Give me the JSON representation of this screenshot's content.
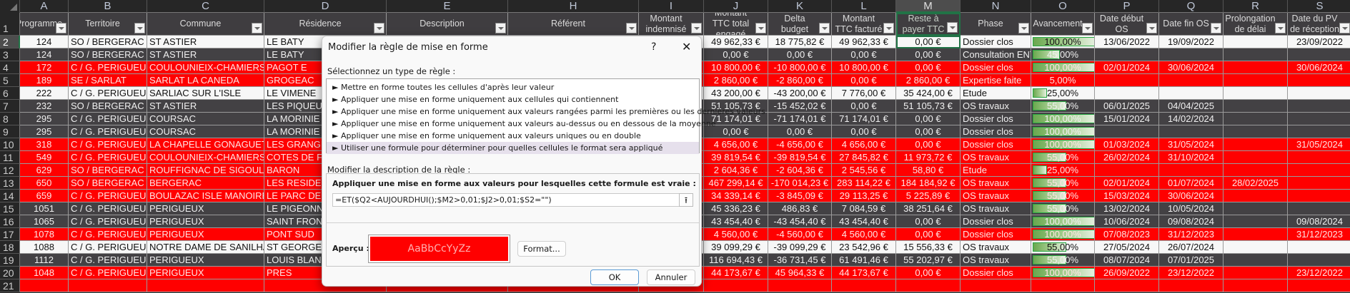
{
  "column_letters": [
    "A",
    "B",
    "C",
    "D",
    "E",
    "H",
    "I",
    "J",
    "K",
    "L",
    "M",
    "N",
    "O",
    "P",
    "Q",
    "R",
    "S"
  ],
  "selected_column": "M",
  "selected_row": "2",
  "colors": {
    "row_white": "#f7f7f7",
    "row_dark": "#434144",
    "row_red": "#ff0000",
    "selection": "#217346",
    "databar": "#6aa84f"
  },
  "headers": [
    "Programme",
    "Territoire",
    "Commune",
    "Résidence",
    "Description",
    "Référent",
    "Montant indemnisé",
    "Montant TTC total engagé",
    "Delta budget",
    "Montant TTC facturé",
    "Reste à payer TTC",
    "Phase",
    "Avancement",
    "Date début OS",
    "Date fin OS",
    "Prolongation de délai",
    "Date du PV de réception"
  ],
  "row_numbers": [
    "1",
    "2",
    "3",
    "4",
    "5",
    "6",
    "7",
    "8",
    "9",
    "10",
    "11",
    "12",
    "13",
    "14",
    "15",
    "16",
    "17",
    "18",
    "19",
    "20",
    "21"
  ],
  "rows": [
    {
      "style": "white",
      "cells": [
        "124",
        "SO / BERGERAC",
        "ST ASTIER",
        "LE BATY",
        "",
        "",
        "",
        "49 962,33 €",
        "18 775,82 €",
        "49 962,33 €",
        "0,00 €",
        "Dossier clos",
        "100,00%",
        "13/06/2022",
        "19/09/2022",
        "",
        "23/09/2022"
      ],
      "progress": 100
    },
    {
      "style": "dark",
      "cells": [
        "124",
        "SO / BERGERAC",
        "ST ASTIER",
        "LE BATY",
        "",
        "",
        "",
        "0,00 €",
        "0,00 €",
        "0,00 €",
        "0,00 €",
        "Consultation ENT",
        "45,00%",
        "",
        "",
        "",
        ""
      ],
      "progress": 45
    },
    {
      "style": "red",
      "cells": [
        "172",
        "C / G. PERIGUEUX",
        "COULOUNIEIX-CHAMIERS",
        "PAGOT E",
        "",
        "",
        "",
        "10 800,00 €",
        "-10 800,00 €",
        "10 800,00 €",
        "0,00 €",
        "Dossier clos",
        "100,00%",
        "02/01/2024",
        "30/06/2024",
        "",
        "30/06/2024"
      ],
      "progress": 100
    },
    {
      "style": "red",
      "cells": [
        "189",
        "SE / SARLAT",
        "SARLAT LA CANEDA",
        "GROGEAC",
        "",
        "",
        "",
        "2 860,00 €",
        "-2 860,00 €",
        "0,00 €",
        "2 860,00 €",
        "Expertise faite",
        "5,00%",
        "",
        "",
        "",
        ""
      ],
      "progress": 5
    },
    {
      "style": "white",
      "cells": [
        "222",
        "C / G. PERIGUEUX",
        "SARLIAC SUR L'ISLE",
        "LE VIMENE",
        "",
        "",
        "",
        "43 200,00 €",
        "-43 200,00 €",
        "7 776,00 €",
        "35 424,00 €",
        "Etude",
        "25,00%",
        "",
        "",
        "",
        ""
      ],
      "progress": 25
    },
    {
      "style": "dark",
      "cells": [
        "232",
        "SO / BERGERAC",
        "ST ASTIER",
        "LES PIQUEURS",
        "",
        "",
        "",
        "51 105,73 €",
        "-15 452,02 €",
        "0,00 €",
        "51 105,73 €",
        "OS travaux",
        "55,00%",
        "06/01/2025",
        "04/04/2025",
        "",
        ""
      ],
      "progress": 55
    },
    {
      "style": "dark",
      "cells": [
        "295",
        "C / G. PERIGUEUX",
        "COURSAC",
        "LA MORINIE 1",
        "",
        "",
        "",
        "71 174,01 €",
        "-71 174,01 €",
        "71 174,01 €",
        "0,00 €",
        "Dossier clos",
        "100,00%",
        "15/01/2024",
        "14/02/2024",
        "",
        ""
      ],
      "progress": 100
    },
    {
      "style": "dark",
      "cells": [
        "295",
        "C / G. PERIGUEUX",
        "COURSAC",
        "LA MORINIE 1",
        "",
        "",
        "",
        "0,00 €",
        "0,00 €",
        "0,00 €",
        "0,00 €",
        "Dossier clos",
        "100,00%",
        "",
        "",
        "",
        ""
      ],
      "progress": 100
    },
    {
      "style": "red",
      "cells": [
        "318",
        "C / G. PERIGUEUX",
        "LA CHAPELLE GONAGUET",
        "LES GRANGES",
        "",
        "",
        "",
        "4 656,00 €",
        "-4 656,00 €",
        "4 656,00 €",
        "0,00 €",
        "Dossier clos",
        "100,00%",
        "01/03/2024",
        "31/05/2024",
        "",
        "31/05/2024"
      ],
      "progress": 100
    },
    {
      "style": "red",
      "cells": [
        "549",
        "C / G. PERIGUEUX",
        "COULOUNIEIX-CHAMIERS",
        "COTES DE FRA",
        "",
        "",
        "",
        "39 819,54 €",
        "-39 819,54 €",
        "27 845,82 €",
        "11 973,72 €",
        "OS travaux",
        "55,00%",
        "26/02/2024",
        "31/10/2024",
        "",
        ""
      ],
      "progress": 55
    },
    {
      "style": "red",
      "cells": [
        "629",
        "SO / BERGERAC",
        "ROUFFIGNAC DE SIGOULES",
        " BARON",
        "",
        "",
        "",
        "2 604,36 €",
        "-2 604,36 €",
        "2 545,56 €",
        "58,80 €",
        "Etude",
        "25,00%",
        "",
        "",
        "",
        ""
      ],
      "progress": 25
    },
    {
      "style": "red",
      "cells": [
        "650",
        "SO / BERGERAC",
        "BERGERAC",
        "LES RESIDENC",
        "",
        "",
        "",
        "467 299,14 €",
        "-170 014,23 €",
        "283 114,22 €",
        "184 184,92 €",
        "OS travaux",
        "55,00%",
        "02/01/2024",
        "01/07/2024",
        "28/02/2025",
        ""
      ],
      "progress": 55
    },
    {
      "style": "red",
      "cells": [
        "659",
        "C / G. PERIGUEUX",
        "BOULAZAC ISLE MANOIRE",
        "LE PARC DES F",
        "",
        "",
        "",
        "34 339,14 €",
        "-3 845,09 €",
        "29 113,25 €",
        "5 225,89 €",
        "OS travaux",
        "55,00%",
        "15/03/2024",
        "30/06/2024",
        "",
        ""
      ],
      "progress": 55
    },
    {
      "style": "dark",
      "cells": [
        "1051",
        "C / G. PERIGUEUX",
        "PERIGUEUX",
        "LE PIGEONNIE",
        "",
        "",
        "",
        "45 336,23 €",
        "486,83 €",
        "7 084,59 €",
        "38 251,64 €",
        "OS travaux",
        "55,00%",
        "13/02/2024",
        "10/05/2024",
        "",
        ""
      ],
      "progress": 55
    },
    {
      "style": "dark",
      "cells": [
        "1065",
        "C / G. PERIGUEUX",
        "PERIGUEUX",
        "SAINT FRONT",
        "",
        "",
        "",
        "43 454,40 €",
        "-43 454,40 €",
        "43 454,40 €",
        "0,00 €",
        "Dossier clos",
        "100,00%",
        "10/06/2024",
        "09/08/2024",
        "",
        "09/08/2024"
      ],
      "progress": 100
    },
    {
      "style": "red",
      "cells": [
        "1078",
        "C / G. PERIGUEUX",
        "PERIGUEUX",
        "PONT SUD",
        "",
        "",
        "",
        "4 560,00 €",
        "-4 560,00 €",
        "4 560,00 €",
        "0,00 €",
        "Dossier clos",
        "100,00%",
        "07/08/2023",
        "31/12/2023",
        "",
        "31/12/2023"
      ],
      "progress": 100
    },
    {
      "style": "white",
      "cells": [
        "1088",
        "C / G. PERIGUEUX",
        "NOTRE DAME DE SANILHAC",
        "ST GEORGES",
        "",
        "",
        "",
        "39 099,29 €",
        "-39 099,29 €",
        "23 542,96 €",
        "15 556,33 €",
        "OS travaux",
        "55,00%",
        "27/05/2024",
        "26/07/2024",
        "",
        ""
      ],
      "progress": 55
    },
    {
      "style": "dark",
      "cells": [
        "1112",
        "C / G. PERIGUEUX",
        "PERIGUEUX",
        "LOUIS BLANC",
        "",
        "",
        "",
        "116 694,43 €",
        "-36 731,45 €",
        "61 491,46 €",
        "55 202,97 €",
        "OS travaux",
        "55,00%",
        "08/07/2024",
        "07/01/2025",
        "",
        ""
      ],
      "progress": 55
    },
    {
      "style": "red",
      "cells": [
        "1048",
        "C / G. PERIGUEUX",
        "PERIGUEUX",
        "PRES",
        "",
        "",
        "",
        "44 173,67 €",
        "45 964,33 €",
        "44 173,67 €",
        "0,00 €",
        "Dossier clos",
        "100,00%",
        "26/09/2022",
        "23/12/2022",
        "",
        "23/12/2022"
      ],
      "progress": 100
    },
    {
      "style": "red",
      "cells": [
        "",
        "",
        "",
        "",
        "",
        "",
        "",
        "",
        "",
        "",
        "",
        "",
        "",
        "",
        "",
        "",
        ""
      ],
      "progress": null
    }
  ],
  "dialog": {
    "title": "Modifier la règle de mise en forme",
    "help": "?",
    "close": "✕",
    "rule_type_label": "Sélectionnez un type de règle :",
    "rule_types": [
      "► Mettre en forme toutes les cellules d'après leur valeur",
      "► Appliquer une mise en forme uniquement aux cellules qui contiennent",
      "► Appliquer une mise en forme uniquement aux valeurs rangées parmi les premières ou les dernières valeurs",
      "► Appliquer une mise en forme uniquement aux valeurs au-dessus ou en dessous de la moyenne",
      "► Appliquer une mise en forme uniquement aux valeurs uniques ou en double",
      "► Utiliser une formule pour déterminer pour quelles cellules le format sera appliqué"
    ],
    "selected_rule_index": 5,
    "description_label": "Modifier la description de la règle :",
    "formula_label": "Appliquer une mise en forme aux valeurs pour lesquelles cette formule est vraie :",
    "formula_value": "=ET($Q2<AUJOURDHUI();$M2>0,01;$J2>0,01;$S2=\"\")",
    "collapse_icon": "⭱",
    "preview_label": "Aperçu :",
    "preview_text": "AaBbCcYyZz",
    "preview_bg": "#ff0000",
    "format_button": "Format...",
    "ok_button": "OK",
    "cancel_button": "Annuler"
  }
}
